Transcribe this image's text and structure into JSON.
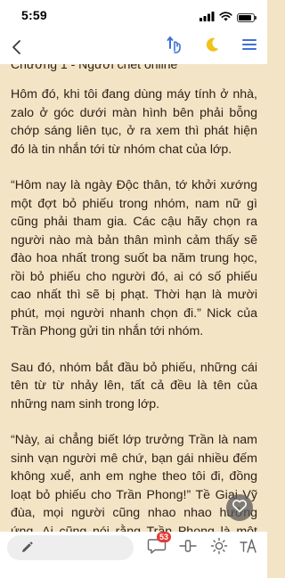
{
  "status_bar": {
    "time": "5:59"
  },
  "reader": {
    "chapter_title": "Chương 1 - Người chết online",
    "paragraphs": [
      "Hôm đó, khi tôi đang dùng máy tính ở nhà, zalo ở góc dưới màn hình bên phải bỗng chớp sáng liên tục, ở ra xem thì phát hiện đó là tin nhắn tới từ nhóm chat của lớp.",
      "“Hôm nay là ngày Độc thân, tớ khởi xướng một đợt bỏ phiếu trong nhóm, nam nữ gì cũng phải tham gia. Các cậu hãy chọn ra người nào mà bản thân mình cảm thấy sẽ đào hoa nhất trong suốt ba năm trung học, rồi bỏ phiếu cho người đó, ai có số phiếu cao nhất thì sẽ bị phạt. Thời hạn là mười phút, mọi người nhanh chọn đi.” Nick của Trần Phong gửi tin nhắn tới nhóm.",
      "Sau đó, nhóm bắt đầu bỏ phiếu, những cái tên từ từ nhảy lên, tất cả đều là tên của những nam sinh trong lớp.",
      "“Này, ai chẳng biết lớp trưởng Trần là nam sinh vạn người mê chứ, bạn gái nhiều đếm không xuể, anh em nghe theo tôi đi, đồng loạt bỏ phiếu cho Trần Phong!” Tề Giai Vỹ đùa, mọi người cũng nhao nhao hưởng ứng. Ai cũng nói rằng Trần Phong là một soái ca giàu có đẹp trai nhất nhì trong lớp"
    ]
  },
  "bottom_bar": {
    "comment_count": "53"
  },
  "colors": {
    "accent": "#3f6fd8",
    "page_bg": "#f4e4c6",
    "moon": "#f2c21a",
    "badge": "#e53935"
  },
  "icons": [
    "back-chevron-icon",
    "auto-scroll-icon",
    "night-mode-moon-icon",
    "menu-list-icon",
    "pencil-icon",
    "comment-icon",
    "slider-icon",
    "brightness-icon",
    "text-size-icon",
    "heart-icon"
  ]
}
